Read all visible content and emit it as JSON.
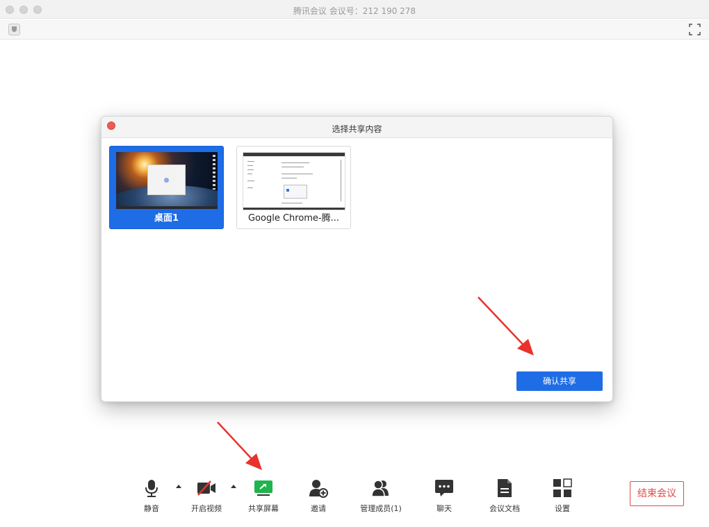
{
  "window": {
    "title": "腾讯会议 会议号：212 190 278"
  },
  "dialog": {
    "title": "选择共享内容",
    "tiles": [
      {
        "label": "桌面1",
        "selected": true
      },
      {
        "label": "Google Chrome-腾...",
        "selected": false
      }
    ],
    "confirm_label": "确认共享"
  },
  "toolbar": {
    "items": [
      {
        "label": "静音",
        "icon": "microphone-icon"
      },
      {
        "label": "开启视频",
        "icon": "video-off-icon"
      },
      {
        "label": "共享屏幕",
        "icon": "share-screen-icon"
      },
      {
        "label": "邀请",
        "icon": "invite-icon"
      },
      {
        "label": "管理成员(1)",
        "icon": "members-icon"
      },
      {
        "label": "聊天",
        "icon": "chat-icon"
      },
      {
        "label": "会议文档",
        "icon": "document-icon"
      },
      {
        "label": "设置",
        "icon": "settings-icon"
      }
    ],
    "end_label": "结束会议"
  },
  "colors": {
    "accent": "#1e6ce6",
    "share_green": "#1fb44c",
    "danger": "#e04a43",
    "icon": "#333333"
  }
}
